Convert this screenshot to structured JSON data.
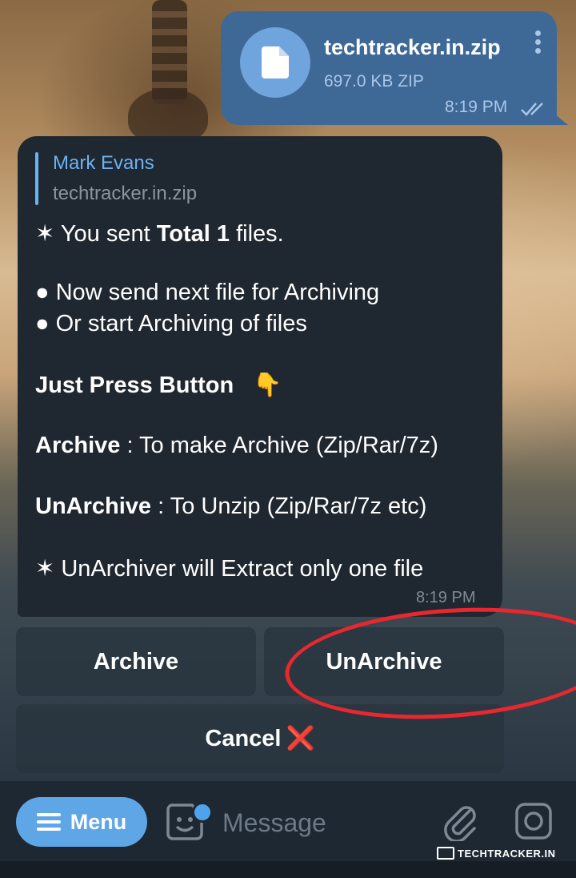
{
  "outgoing_file": {
    "name": "techtracker.in.zip",
    "meta": "697.0 KB ZIP",
    "time": "8:19 PM"
  },
  "bot_message": {
    "reply_author": "Mark Evans",
    "reply_file": "techtracker.in.zip",
    "line1_pre": "✶ You sent ",
    "line1_bold": "Total 1",
    "line1_post": " files.",
    "line2": "● Now send next file for Archiving",
    "line3": "● Or start Archiving of files",
    "line4": "Just Press Button",
    "line4_emoji": "👇",
    "line5_bold": "Archive",
    "line5_rest": " : To make Archive (Zip/Rar/7z)",
    "line6_bold": "UnArchive",
    "line6_rest": " : To Unzip (Zip/Rar/7z etc)",
    "line7": "✶ UnArchiver will Extract only one file",
    "time": "8:19 PM"
  },
  "keyboard": {
    "archive": "Archive",
    "unarchive": "UnArchive",
    "cancel": "Cancel",
    "cancel_icon": "❌"
  },
  "input_bar": {
    "menu_label": "Menu",
    "placeholder": "Message"
  },
  "watermark": "TECHTRACKER.IN",
  "colors": {
    "outgoing_bubble": "#3e6896",
    "incoming_bubble": "#1f2730",
    "accent": "#6ab3f3",
    "menu_button": "#5ea6e6",
    "annotation_circle": "#e8282e"
  }
}
